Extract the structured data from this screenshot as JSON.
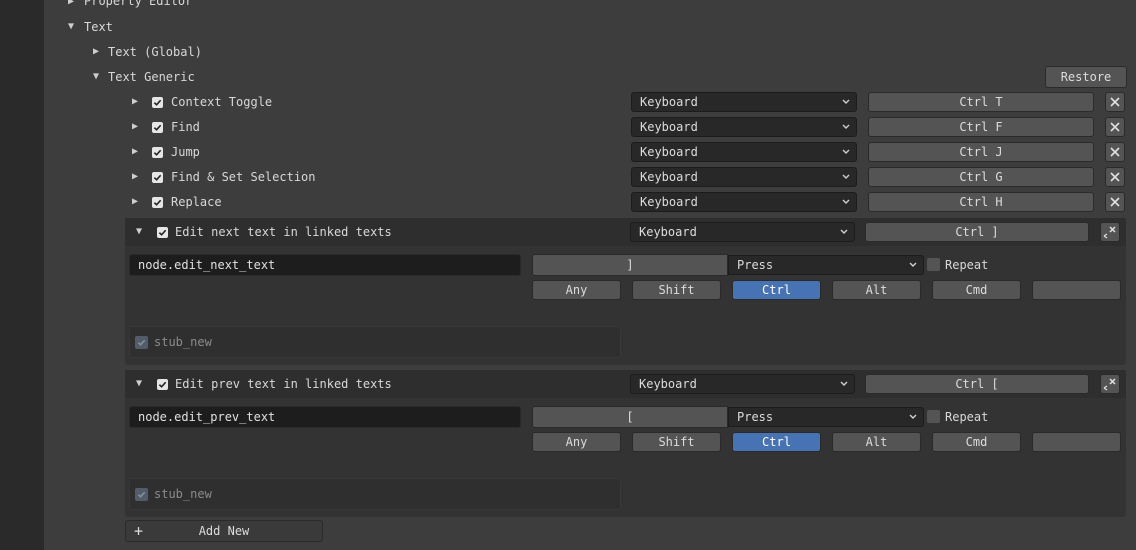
{
  "tree": {
    "property_editor": "Property Editor",
    "text": "Text",
    "text_global": "Text (Global)",
    "text_generic": "Text Generic"
  },
  "restore_label": "Restore",
  "keymap_items": [
    {
      "name": "Context Toggle",
      "type": "Keyboard",
      "key": "Ctrl T"
    },
    {
      "name": "Find",
      "type": "Keyboard",
      "key": "Ctrl F"
    },
    {
      "name": "Jump",
      "type": "Keyboard",
      "key": "Ctrl J"
    },
    {
      "name": "Find & Set Selection",
      "type": "Keyboard",
      "key": "Ctrl G"
    },
    {
      "name": "Replace",
      "type": "Keyboard",
      "key": "Ctrl H"
    }
  ],
  "expanded_items": [
    {
      "name": "Edit next text in linked texts",
      "type": "Keyboard",
      "key": "Ctrl ]",
      "operator": "node.edit_next_text",
      "key_value": "]",
      "event": "Press",
      "repeat_label": "Repeat",
      "modifiers": [
        "Any",
        "Shift",
        "Ctrl",
        "Alt",
        "Cmd",
        ""
      ],
      "active_modifier": "Ctrl",
      "stub_label": "stub_new"
    },
    {
      "name": "Edit prev text in linked texts",
      "type": "Keyboard",
      "key": "Ctrl [",
      "operator": "node.edit_prev_text",
      "key_value": "[",
      "event": "Press",
      "repeat_label": "Repeat",
      "modifiers": [
        "Any",
        "Shift",
        "Ctrl",
        "Alt",
        "Cmd",
        ""
      ],
      "active_modifier": "Ctrl",
      "stub_label": "stub_new"
    }
  ],
  "add_new_label": "Add New",
  "colors": {
    "background": "#303030",
    "panel": "#3d3d3d",
    "button": "#545454",
    "accent": "#4772b3",
    "field": "#1d1d1d"
  }
}
